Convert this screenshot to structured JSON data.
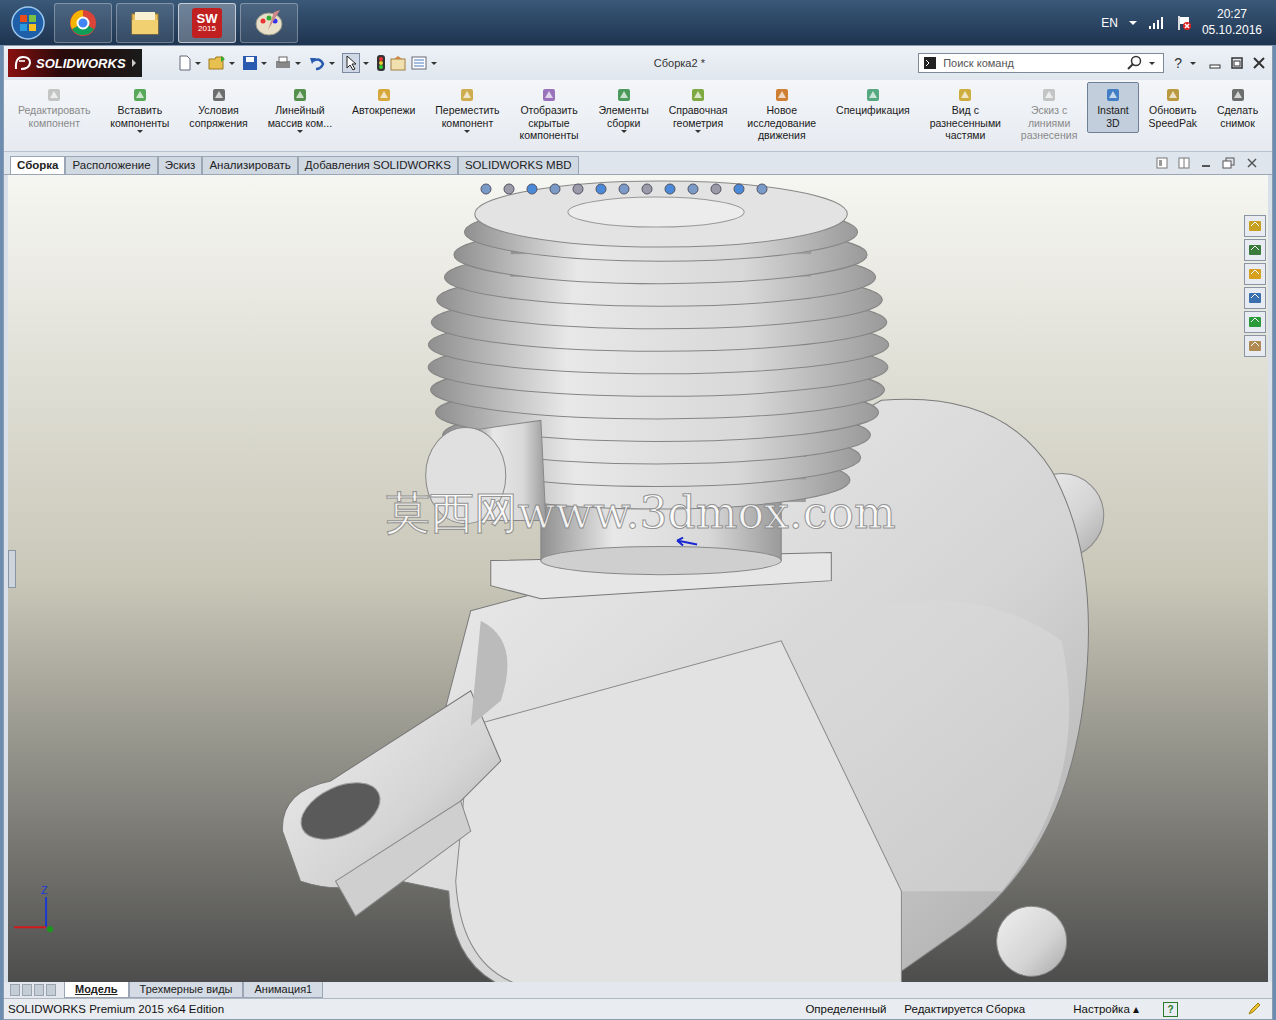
{
  "taskbar": {
    "apps": [
      {
        "kind": "chrome",
        "active": false
      },
      {
        "kind": "explorer",
        "active": false
      },
      {
        "kind": "solidworks",
        "active": true,
        "text": "SW",
        "badge": "2015"
      },
      {
        "kind": "paint",
        "active": false
      }
    ]
  },
  "tray": {
    "language": "EN",
    "time": "20:27",
    "date": "05.10.2016"
  },
  "window": {
    "app": "SOLIDWORKS",
    "title": "Сборка2 *",
    "search": {
      "placeholder": "Поиск команд"
    },
    "help": "?"
  },
  "ribbon": [
    {
      "lines": [
        "Редактировать",
        "компонент"
      ],
      "disabled": true,
      "selected": false,
      "dropdown": false
    },
    {
      "lines": [
        "Вставить",
        "компоненты"
      ],
      "disabled": false,
      "selected": false,
      "dropdown": true
    },
    {
      "lines": [
        "Условия",
        "сопряжения"
      ],
      "disabled": false,
      "selected": false,
      "dropdown": false
    },
    {
      "lines": [
        "Линейный",
        "массив ком..."
      ],
      "disabled": false,
      "selected": false,
      "dropdown": true
    },
    {
      "lines": [
        "Автокрепежи"
      ],
      "disabled": false,
      "selected": false,
      "dropdown": false
    },
    {
      "lines": [
        "Переместить",
        "компонент"
      ],
      "disabled": false,
      "selected": false,
      "dropdown": true
    },
    {
      "lines": [
        "Отобразить",
        "скрытые",
        "компоненты"
      ],
      "disabled": false,
      "selected": false,
      "dropdown": false
    },
    {
      "lines": [
        "Элементы",
        "сборки"
      ],
      "disabled": false,
      "selected": false,
      "dropdown": true
    },
    {
      "lines": [
        "Справочная",
        "геометрия"
      ],
      "disabled": false,
      "selected": false,
      "dropdown": true
    },
    {
      "lines": [
        "Новое",
        "исследование",
        "движения"
      ],
      "disabled": false,
      "selected": false,
      "dropdown": false
    },
    {
      "lines": [
        "Спецификация"
      ],
      "disabled": false,
      "selected": false,
      "dropdown": false
    },
    {
      "lines": [
        "Вид с",
        "разнесенными",
        "частями"
      ],
      "disabled": false,
      "selected": false,
      "dropdown": false
    },
    {
      "lines": [
        "Эскиз с",
        "линиями",
        "разнесения"
      ],
      "disabled": true,
      "selected": false,
      "dropdown": false
    },
    {
      "lines": [
        "Instant",
        "3D"
      ],
      "disabled": false,
      "selected": true,
      "dropdown": false
    },
    {
      "lines": [
        "Обновить",
        "SpeedPak"
      ],
      "disabled": false,
      "selected": false,
      "dropdown": false
    },
    {
      "lines": [
        "Сделать",
        "снимок"
      ],
      "disabled": false,
      "selected": false,
      "dropdown": false
    }
  ],
  "tabs": [
    {
      "label": "Сборка",
      "selected": true
    },
    {
      "label": "Расположение",
      "selected": false
    },
    {
      "label": "Эскиз",
      "selected": false
    },
    {
      "label": "Анализировать",
      "selected": false
    },
    {
      "label": "Добавления SOLIDWORKS",
      "selected": false
    },
    {
      "label": "SOLIDWORKS MBD",
      "selected": false
    }
  ],
  "viewport": {
    "watermark": "莫西网www.3dmox.com",
    "axis": "Z"
  },
  "bottom_tabs": [
    {
      "label": "Модель",
      "selected": true
    },
    {
      "label": "Трехмерные виды",
      "selected": false
    },
    {
      "label": "Анимация1",
      "selected": false
    }
  ],
  "status_bar": {
    "edition": "SOLIDWORKS Premium 2015 x64 Edition",
    "state": "Определенный",
    "mode": "Редактируется Сборка",
    "custom": "Настройка",
    "custom_arrow": "▴",
    "help": "?"
  }
}
